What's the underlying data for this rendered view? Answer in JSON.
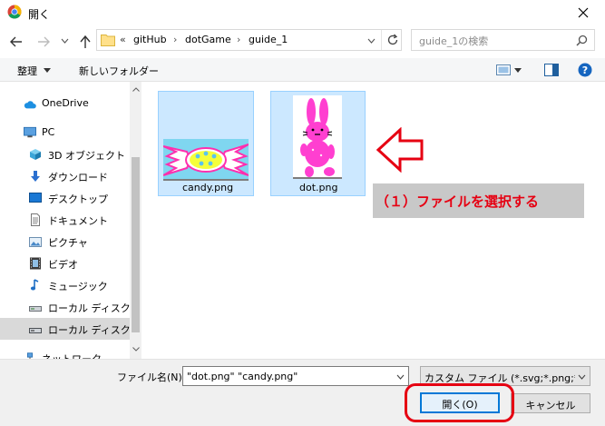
{
  "window": {
    "title": "開く"
  },
  "nav": {
    "path": [
      "«",
      "gitHub",
      "dotGame",
      "guide_1"
    ]
  },
  "search": {
    "placeholder": "guide_1の検索"
  },
  "toolbar": {
    "organize": "整理",
    "new_folder": "新しいフォルダー"
  },
  "sidebar": {
    "items": [
      {
        "label": "OneDrive",
        "icon": "cloud-icon"
      },
      {
        "label": "PC",
        "icon": "pc-icon"
      },
      {
        "label": "3D オブジェクト",
        "icon": "cube-icon"
      },
      {
        "label": "ダウンロード",
        "icon": "download-icon"
      },
      {
        "label": "デスクトップ",
        "icon": "desktop-icon"
      },
      {
        "label": "ドキュメント",
        "icon": "document-icon"
      },
      {
        "label": "ピクチャ",
        "icon": "picture-icon"
      },
      {
        "label": "ビデオ",
        "icon": "video-icon"
      },
      {
        "label": "ミュージック",
        "icon": "music-icon"
      },
      {
        "label": "ローカル ディスク (C",
        "icon": "disk-icon"
      },
      {
        "label": "ローカル ディスク (D",
        "icon": "disk-icon"
      },
      {
        "label": "ネットワーク",
        "icon": "network-icon"
      }
    ]
  },
  "files": [
    {
      "name": "candy.png",
      "selected": true
    },
    {
      "name": "dot.png",
      "selected": true
    }
  ],
  "annotation": {
    "text": "（１）ファイルを選択する"
  },
  "bottom": {
    "filename_label": "ファイル名(N):",
    "filename_value": "\"dot.png\" \"candy.png\"",
    "filter_value": "カスタム ファイル (*.svg;*.png;*.jpg",
    "open_label": "開く(O)",
    "cancel_label": "キャンセル"
  },
  "colors": {
    "selection": "#cce8ff",
    "accent": "#0078d7",
    "annotation_red": "#e60012",
    "annotation_bg": "#c8c8c8"
  }
}
